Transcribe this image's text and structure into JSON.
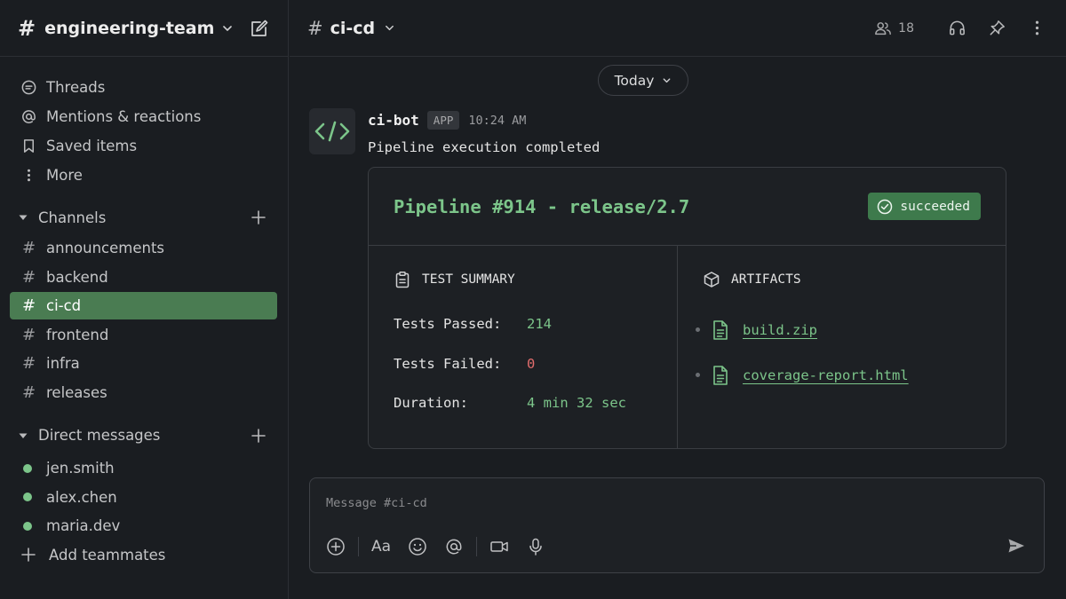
{
  "workspace": {
    "name": "engineering-team",
    "compose_icon": "compose-icon"
  },
  "nav": [
    {
      "label": "Threads",
      "icon": "threads-icon"
    },
    {
      "label": "Mentions & reactions",
      "icon": "at-icon"
    },
    {
      "label": "Saved items",
      "icon": "bookmark-icon"
    },
    {
      "label": "More",
      "icon": "more-vertical-icon"
    }
  ],
  "channels_section": {
    "title": "Channels",
    "items": [
      "announcements",
      "backend",
      "ci-cd",
      "frontend",
      "infra",
      "releases"
    ],
    "active": "ci-cd"
  },
  "dm_section": {
    "title": "Direct messages",
    "items": [
      "jen.smith",
      "alex.chen",
      "maria.dev"
    ],
    "add_label": "Add teammates"
  },
  "channel_header": {
    "name": "ci-cd",
    "member_count": "18"
  },
  "date_divider": "Today",
  "message": {
    "author": "ci-bot",
    "badge": "APP",
    "time": "10:24 AM",
    "text": "Pipeline execution completed"
  },
  "pipeline_card": {
    "title": "Pipeline #914 - release/2.7",
    "status": "succeeded",
    "test_summary": {
      "title": "TEST SUMMARY",
      "rows": [
        {
          "label": "Tests Passed:",
          "value": "214"
        },
        {
          "label": "Tests Failed:",
          "value": "0"
        },
        {
          "label": "Duration:",
          "value": "4 min 32 sec"
        }
      ]
    },
    "artifacts": {
      "title": "ARTIFACTS",
      "files": [
        "build.zip",
        "coverage-report.html"
      ]
    }
  },
  "composer": {
    "placeholder": "Message #ci-cd",
    "format_label": "Aa"
  },
  "colors": {
    "accent_green": "#7cc58a",
    "active_channel": "#4a7c52",
    "status_success": "#3e7a4c",
    "fail_red": "#e06c6c",
    "background": "#1a1d21"
  }
}
